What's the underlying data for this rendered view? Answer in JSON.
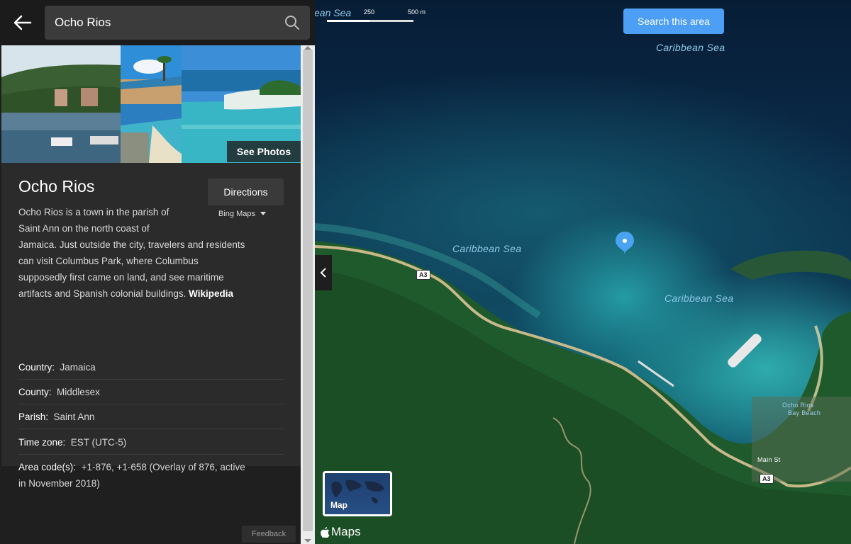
{
  "search": {
    "value": "Ocho Rios"
  },
  "place": {
    "name": "Ocho Rios",
    "see_photos": "See Photos",
    "directions": "Directions",
    "provider": "Bing Maps",
    "description_lines": [
      "Ocho Rios is a town in the parish of",
      "Saint Ann on the north coast of",
      "Jamaica. Just outside the city, travelers and residents",
      "can visit Columbus Park, where Columbus",
      "supposedly first came on land, and see maritime",
      "artifacts and Spanish colonial buildings."
    ],
    "wikipedia": "Wikipedia",
    "facts": [
      {
        "label": "Country:",
        "value": "Jamaica"
      },
      {
        "label": "County:",
        "value": "Middlesex"
      },
      {
        "label": "Parish:",
        "value": "Saint Ann"
      },
      {
        "label": "Time zone:",
        "value": "EST (UTC-5)"
      },
      {
        "label": "Area code(s):",
        "value": "+1-876, +1-658 (Overlay of 876, active",
        "value_line2": "in November 2018)"
      }
    ],
    "feedback": "Feedback"
  },
  "map": {
    "search_area_button": "Search this area",
    "scale": {
      "sea_fragment": "ean Sea",
      "label_250": "250",
      "label_500": "500 m"
    },
    "labels": [
      "Caribbean Sea",
      "Caribbean Sea",
      "Caribbean Sea"
    ],
    "road_badges": [
      "A3",
      "A3"
    ],
    "street_label": "Main St",
    "poi_label_1": "Ocho Rios",
    "poi_label_2": "Bay Beach",
    "map_type": "Map",
    "brand": "Maps"
  },
  "colors": {
    "accent": "#4d9ff5",
    "panel": "#2b2b2b",
    "topbar": "#1b1b1b"
  }
}
